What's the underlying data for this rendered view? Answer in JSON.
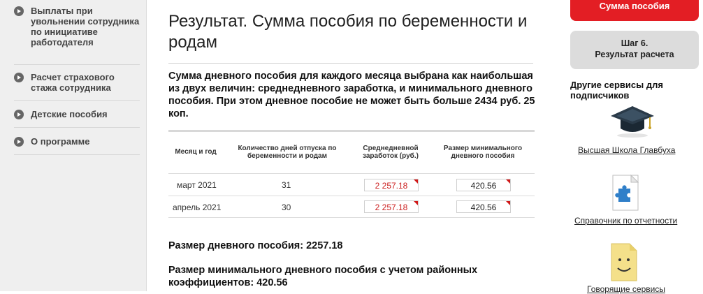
{
  "sidebar": {
    "items": [
      {
        "label": "Выплаты при увольнении сотрудника по инициативе работодателя"
      },
      {
        "label": "Расчет страхового стажа сотрудника"
      },
      {
        "label": "Детские пособия"
      },
      {
        "label": "О программе"
      }
    ]
  },
  "main": {
    "title": "Результат. Сумма пособия по беременности и родам",
    "description": "Сумма дневного пособия для каждого месяца выбрана как наибольшая из двух величин: среднедневного заработка, и минимального дневного пособия. При этом дневное пособие не может быть больше 2434 руб. 25 коп.",
    "table": {
      "headers": [
        "Месяц и год",
        "Количество дней отпуска по беременности и родам",
        "Среднедневной заработок (руб.)",
        "Размер минимального дневного пособия"
      ],
      "rows": [
        {
          "month": "март 2021",
          "days": "31",
          "avg": "2 257.18",
          "min": "420.56"
        },
        {
          "month": "апрель 2021",
          "days": "30",
          "avg": "2 257.18",
          "min": "420.56"
        }
      ]
    },
    "result_daily": "Размер дневного пособия: 2257.18",
    "result_min": "Размер минимального дневного пособия с учетом районных коэффициентов: 420.56"
  },
  "right": {
    "red_button": "Сумма пособия",
    "step_line1": "Шаг 6.",
    "step_line2": "Результат расчета",
    "other_services": "Другие сервисы для подписчиков",
    "services": [
      {
        "label": "Высшая Школа Главбуха",
        "icon": "graduation-cap-icon"
      },
      {
        "label": "Справочник по отчетности",
        "icon": "puzzle-document-icon"
      },
      {
        "label": "Говорящие сервисы",
        "icon": "smiling-document-icon"
      }
    ]
  },
  "colors": {
    "accent_red": "#e31e24",
    "sidebar_bg": "#efefef",
    "step_bg": "#dcdcdc"
  }
}
